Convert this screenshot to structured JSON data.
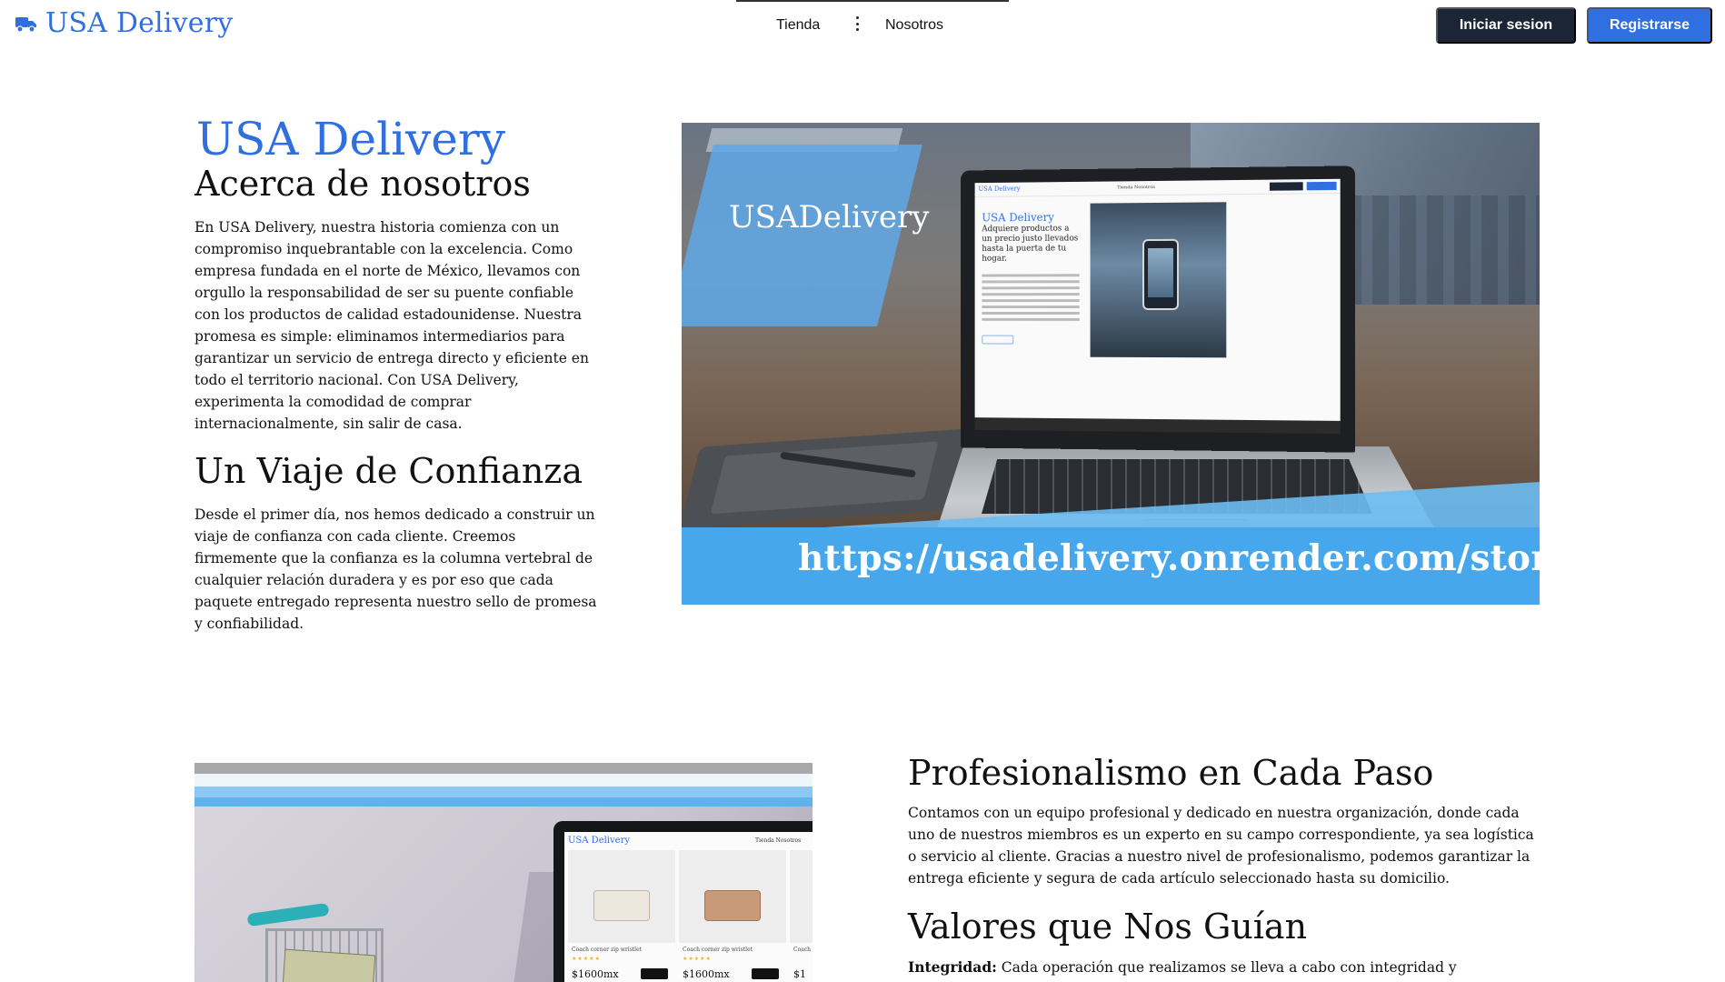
{
  "nav": {
    "brand": "USA Delivery",
    "links": [
      {
        "label": "Tienda"
      },
      {
        "label": "Nosotros"
      }
    ],
    "login_label": "Iniciar sesion",
    "register_label": "Registrarse"
  },
  "about": {
    "brand_title": "USA Delivery",
    "heading1": "Acerca de nosotros",
    "paragraph1": "En USA Delivery, nuestra historia comienza con un compromiso inquebrantable con la excelencia. Como empresa fundada en el norte de México, llevamos con orgullo la responsabilidad de ser su puente confiable con los productos de calidad estadounidense. Nuestra promesa es simple: eliminamos intermediarios para garantizar un servicio de entrega directo y eficiente en todo el territorio nacional. Con USA Delivery, experimenta la comodidad de comprar internacionalmente, sin salir de casa.",
    "heading2": "Un Viaje de Confianza",
    "paragraph2": "Desde el primer día, nos hemos dedicado a construir un viaje de confianza con cada cliente. Creemos firmemente que la confianza es la columna vertebral de cualquier relación duradera y es por eso que cada paquete entregado representa nuestro sello de promesa y confiabilidad."
  },
  "hero_image": {
    "logo_text": "USADelivery",
    "url_text": "https://usadelivery.onrender.com/store/",
    "screen": {
      "brand": "USA Delivery",
      "links": "Tienda     Nosotros",
      "title": "USA Delivery",
      "subtitle": "Adquiere productos a un precio justo llevados hasta la puerta de tu hogar."
    }
  },
  "section2": {
    "screen": {
      "brand": "USA Delivery",
      "links": "Tienda     Nosotros",
      "products": [
        {
          "name": "Coach corner zip wristlet",
          "price": "$1600mx"
        },
        {
          "name": "Coach corner zip wristlet",
          "price": "$1600mx"
        },
        {
          "name": "Coach",
          "price": "$1"
        }
      ]
    },
    "heading1": "Profesionalismo en Cada Paso",
    "paragraph1": "Contamos con un equipo profesional y dedicado en nuestra organización, donde cada uno de nuestros miembros es un experto en su campo correspondiente, ya sea logística o servicio al cliente. Gracias a nuestro nivel de profesionalismo, podemos garantizar la entrega eficiente y segura de cada artículo seleccionado hasta su domicilio.",
    "heading2": "Valores que Nos Guían",
    "value1_label": "Integridad:",
    "value1_text": " Cada operación que realizamos se lleva a cabo con integridad y"
  },
  "colors": {
    "brand_blue": "#2f6fe0",
    "login_bg": "#1b2535",
    "register_bg": "#2f6fe0",
    "banner_blue": "#47a7ec"
  }
}
